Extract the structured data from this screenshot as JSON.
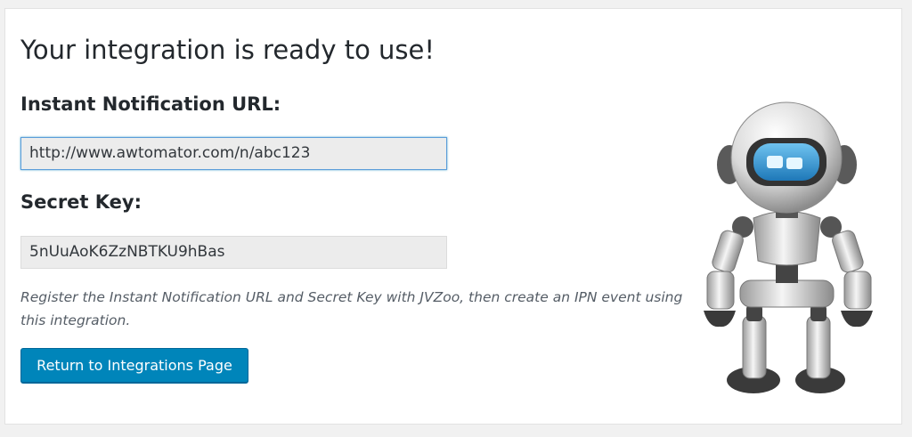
{
  "page": {
    "title": "Your integration is ready to use!"
  },
  "fields": {
    "url_label": "Instant Notification URL:",
    "url_value": "http://www.awtomator.com/n/abc123",
    "key_label": "Secret Key:",
    "key_value": "5nUuAoK6ZzNBTKU9hBas"
  },
  "description": "Register the Instant Notification URL and Secret Key with JVZoo, then create an IPN event using this integration.",
  "actions": {
    "return_label": "Return to Integrations Page"
  },
  "colors": {
    "primary_button": "#0085ba",
    "focus_border": "#5b9dd9"
  },
  "icons": {
    "mascot": "robot-mascot-icon"
  }
}
